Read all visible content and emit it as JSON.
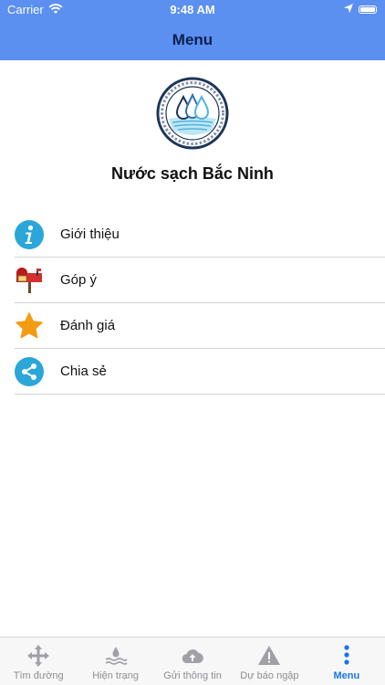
{
  "status_bar": {
    "carrier": "Carrier",
    "time": "9:48 AM",
    "icons": [
      "wifi-icon",
      "location-arrow-icon",
      "battery-icon"
    ]
  },
  "nav": {
    "title": "Menu"
  },
  "header": {
    "company_name": "Nước sạch Bắc Ninh",
    "logo": "water-drops-logo"
  },
  "menu": {
    "items": [
      {
        "label": "Giới thiệu",
        "icon": "info-icon"
      },
      {
        "label": "Góp ý",
        "icon": "mailbox-icon"
      },
      {
        "label": "Đánh giá",
        "icon": "star-icon"
      },
      {
        "label": "Chia sẻ",
        "icon": "share-icon"
      }
    ]
  },
  "tabbar": {
    "tabs": [
      {
        "label": "Tìm đường",
        "icon": "move-arrows-icon"
      },
      {
        "label": "Hiện trạng",
        "icon": "water-level-icon"
      },
      {
        "label": "Gửi thông tin",
        "icon": "cloud-upload-icon"
      },
      {
        "label": "Dự báo ngập",
        "icon": "warning-icon"
      },
      {
        "label": "Menu",
        "icon": "more-dots-icon",
        "active": true
      }
    ]
  },
  "colors": {
    "nav_background": "#5b8ff0",
    "accent": "#1a73e8",
    "info_icon": "#2aa6d9",
    "star_icon": "#f39c12",
    "share_icon": "#2aa6d9"
  }
}
